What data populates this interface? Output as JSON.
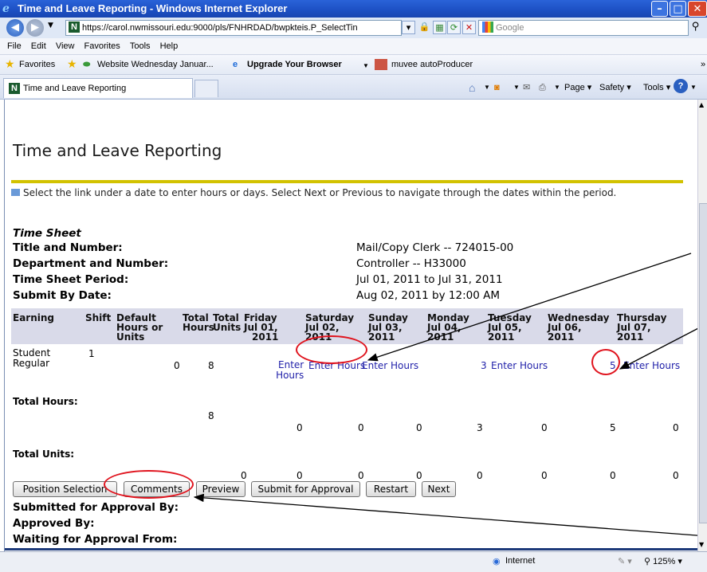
{
  "window": {
    "title": "Time and Leave Reporting - Windows Internet Explorer"
  },
  "address": {
    "url": "https://carol.nwmissouri.edu:9000/pls/FNHRDAD/bwpkteis.P_SelectTin",
    "search_placeholder": "Google"
  },
  "menu": [
    "File",
    "Edit",
    "View",
    "Favorites",
    "Tools",
    "Help"
  ],
  "favorites": {
    "label": "Favorites",
    "items": [
      "Website Wednesday Januar...",
      "Upgrade Your Browser",
      "muvee autoProducer"
    ]
  },
  "tab": {
    "title": "Time and Leave Reporting"
  },
  "commandbar": {
    "page": "Page",
    "safety": "Safety",
    "tools": "Tools"
  },
  "page": {
    "title": "Time and Leave Reporting",
    "instruction": "Select the link under a date to enter hours or days. Select Next or Previous to navigate through the dates within the period.",
    "sheet_heading": "Time Sheet",
    "fields": [
      {
        "label": "Title and Number:",
        "value": "Mail/Copy Clerk -- 724015-00"
      },
      {
        "label": "Department and Number:",
        "value": "Controller -- H33000"
      },
      {
        "label": "Time Sheet Period:",
        "value": "Jul 01, 2011 to Jul 31, 2011"
      },
      {
        "label": "Submit By Date:",
        "value": "Aug 02, 2011 by 12:00 AM"
      }
    ],
    "columns": {
      "earning": "Earning",
      "shift": "Shift",
      "default": [
        "Default",
        "Hours or",
        "Units"
      ],
      "total_hours": [
        "Total",
        "Hours"
      ],
      "total_units": [
        "Total",
        "Units"
      ],
      "days": [
        [
          "Friday",
          "Jul 01,",
          "2011"
        ],
        [
          "Saturday",
          "Jul 02,",
          "2011"
        ],
        [
          "Sunday",
          "Jul 03,",
          "2011"
        ],
        [
          "Monday",
          "Jul 04,",
          "2011"
        ],
        [
          "Tuesday",
          "Jul 05,",
          "2011"
        ],
        [
          "Wednesday",
          "Jul 06,",
          "2011"
        ],
        [
          "Thursday",
          "Jul 07,",
          "2011"
        ]
      ]
    },
    "row": {
      "earning": [
        "Student",
        "Regular"
      ],
      "shift": "1",
      "default": "0",
      "total_hours": "8",
      "enter_hours_split": [
        "Enter",
        "Hours"
      ],
      "enter_hours": "Enter Hours",
      "monday_value": "3",
      "wednesday_value": "5"
    },
    "total_hours": {
      "label": "Total Hours:",
      "total": "8",
      "days": [
        "0",
        "0",
        "0",
        "3",
        "0",
        "5",
        "0"
      ]
    },
    "total_units": {
      "label": "Total Units:",
      "total": "0",
      "days": [
        "0",
        "0",
        "0",
        "0",
        "0",
        "0",
        "0"
      ]
    },
    "buttons": [
      "Position Selection",
      "Comments",
      "Preview",
      "Submit for Approval",
      "Restart",
      "Next"
    ],
    "approval": [
      "Submitted for Approval By:",
      "Approved By:",
      "Waiting for Approval From:"
    ]
  },
  "status": {
    "zone": "Internet",
    "zoom": "125%"
  },
  "colors": {
    "annotation_red": "#e0141e",
    "rule_yellow": "#d2c200",
    "header_bg": "#d9dae9",
    "link_blue": "#2222aa"
  }
}
